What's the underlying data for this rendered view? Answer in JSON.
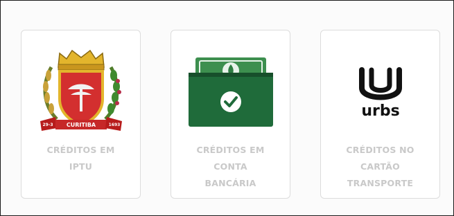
{
  "cards": [
    {
      "icon": "curitiba-coat-of-arms-icon",
      "label_lines": [
        "CRÉDITOS EM",
        "IPTU"
      ],
      "ribbon_left": "29-3",
      "ribbon_center": "CURITIBA",
      "ribbon_right": "1693"
    },
    {
      "icon": "wallet-check-icon",
      "label_lines": [
        "CRÉDITOS EM",
        "CONTA",
        "BANCÁRIA"
      ]
    },
    {
      "icon": "urbs-logo-icon",
      "logo_text": "urbs",
      "label_lines": [
        "CRÉDITOS NO",
        "CARTÃO",
        "TRANSPORTE"
      ]
    }
  ],
  "colors": {
    "label": "#c9c9c9",
    "card_border": "#dcdcdc",
    "wallet_green": "#1f6b3a",
    "crest_red": "#d32f2f",
    "crest_gold": "#e3b52c"
  }
}
